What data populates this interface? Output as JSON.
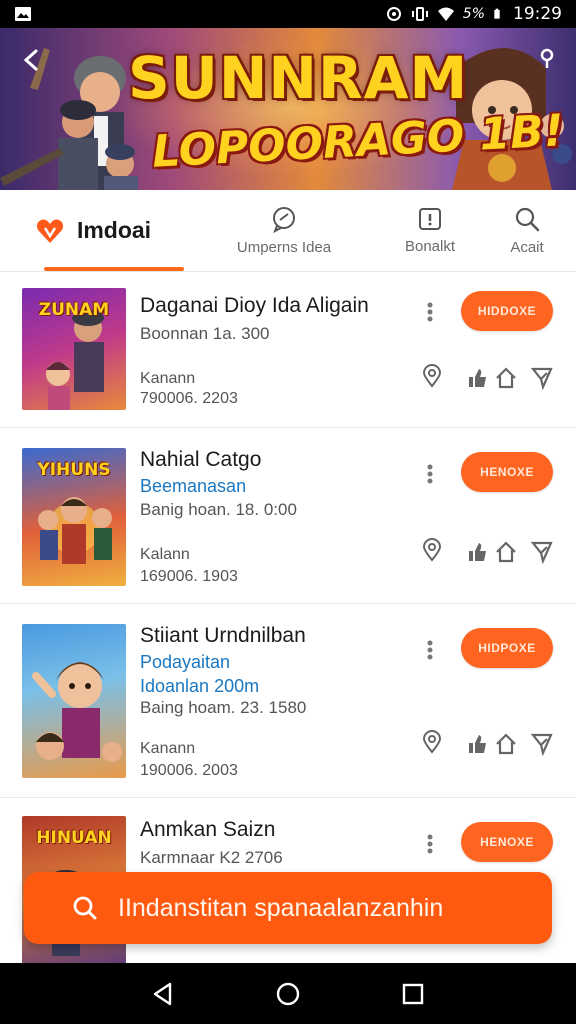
{
  "status_bar": {
    "time": "19:29",
    "signal_text": "5%",
    "icons": [
      "image-icon",
      "hotspot-icon",
      "vibrate-icon",
      "wifi-icon",
      "cell-signal-icon",
      "battery-icon"
    ]
  },
  "banner": {
    "title_line1": "SUNNRAM",
    "title_line2": "LOPOORAGO 1B!"
  },
  "tabs": [
    {
      "label": "Imdoai",
      "icon": "heart-logo-icon",
      "active": true
    },
    {
      "label": "Umperns Idea",
      "icon": "chat-bubble-icon",
      "active": false
    },
    {
      "label": "Bonalkt",
      "icon": "info-box-icon",
      "active": false
    },
    {
      "label": "Acait",
      "icon": "search-icon",
      "active": false
    }
  ],
  "items": [
    {
      "title": "Daganai Dioy Ida Aligain",
      "subtitle": "",
      "line1": "Boonnan 1a. 300",
      "line2": "",
      "meta1": "Kanann",
      "meta2": "790006. 2203",
      "button": "HIDDOXE",
      "thumb_title": "ZUNAM"
    },
    {
      "title": "Nahial Catgo",
      "subtitle": "Beemanasan",
      "line1": "Banig hoan. 18. 0:00",
      "line2": "",
      "meta1": "Kalann",
      "meta2": "169006. 1903",
      "button": "HENOXE",
      "thumb_title": "YIHUNS"
    },
    {
      "title": "Stiiant Urndnilban",
      "subtitle": "Podayaitan",
      "line1": "Idoanlan 200m",
      "line2": "Baing hoam. 23. 1580",
      "meta1": "Kanann",
      "meta2": "190006. 2003",
      "button": "HIDPOXE",
      "thumb_title": ""
    },
    {
      "title": "Anmkan Saizn",
      "subtitle": "",
      "line1": "Karmnaar K2 2706",
      "line2": "",
      "meta1": "",
      "meta2": "",
      "button": "HENOXE",
      "thumb_title": "HINUAN"
    }
  ],
  "search_fab": {
    "label": "IIndanstitan spanaalanzanhin",
    "icon": "search-icon"
  },
  "nav_bar": {
    "icons": [
      "back-triangle-icon",
      "home-circle-icon",
      "recents-square-icon"
    ]
  },
  "colors": {
    "accent": "#ff6420",
    "fab": "#ff5a10",
    "link_blue": "#1a78c2"
  }
}
